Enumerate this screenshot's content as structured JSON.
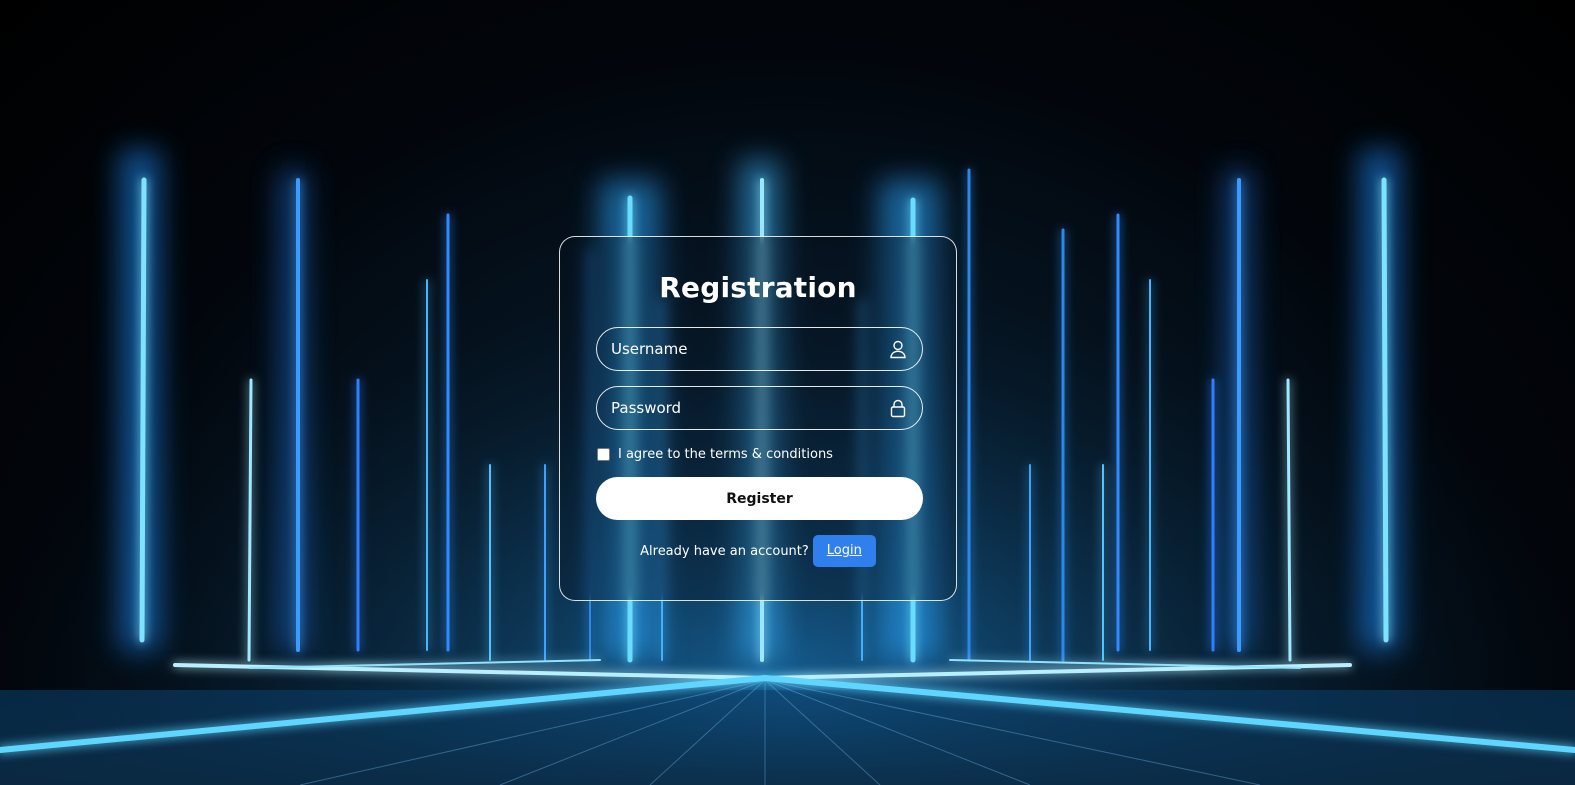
{
  "form": {
    "title": "Registration",
    "username": {
      "placeholder": "Username",
      "value": "",
      "icon": "user-icon"
    },
    "password": {
      "placeholder": "Password",
      "value": "",
      "icon": "lock-icon"
    },
    "terms": {
      "label": "I agree to the terms & conditions",
      "checked": false
    },
    "register_label": "Register",
    "login_prompt": "Already have an account?",
    "login_label": "Login"
  },
  "colors": {
    "background": "#02060c",
    "glow": "#36c4ff",
    "link_button": "#2f80ed",
    "button": "#ffffff"
  }
}
